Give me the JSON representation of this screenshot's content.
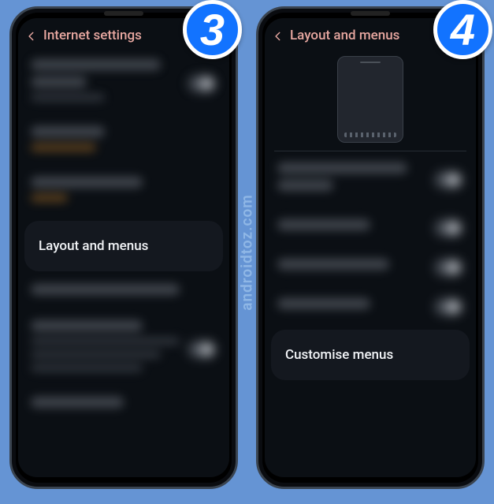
{
  "watermark": "androidtoz.com",
  "badges": {
    "step3": "3",
    "step4": "4"
  },
  "phone1": {
    "header": {
      "title": "Internet settings"
    },
    "highlight": {
      "label": "Layout and menus"
    }
  },
  "phone2": {
    "header": {
      "title": "Layout and menus"
    },
    "highlight": {
      "label": "Customise menus"
    }
  }
}
